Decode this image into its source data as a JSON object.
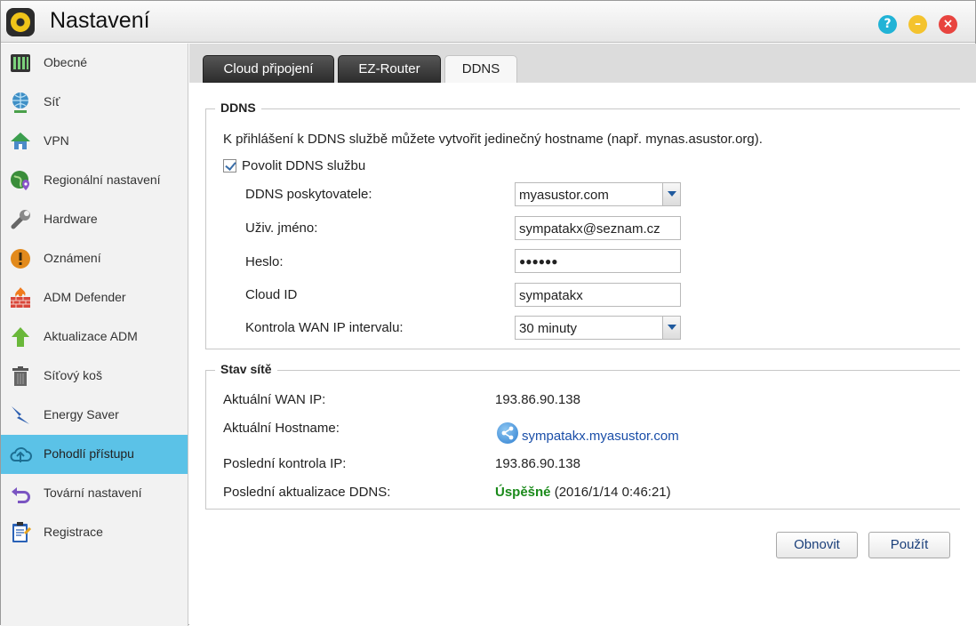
{
  "window": {
    "title": "Nastavení",
    "controls": {
      "help": "?",
      "minimize": "–",
      "close": "×"
    }
  },
  "sidebar": {
    "items": [
      {
        "label": "Obecné",
        "icon": "server-icon"
      },
      {
        "label": "Síť",
        "icon": "globe-network-icon"
      },
      {
        "label": "VPN",
        "icon": "vpn-house-icon"
      },
      {
        "label": "Regionální nastavení",
        "icon": "globe-pin-icon"
      },
      {
        "label": "Hardware",
        "icon": "wrench-icon"
      },
      {
        "label": "Oznámení",
        "icon": "alert-icon"
      },
      {
        "label": "ADM Defender",
        "icon": "firewall-icon"
      },
      {
        "label": "Aktualizace ADM",
        "icon": "up-arrow-icon"
      },
      {
        "label": "Síťový koš",
        "icon": "trash-icon"
      },
      {
        "label": "Energy Saver",
        "icon": "energy-icon"
      },
      {
        "label": "Pohodlí přístupu",
        "icon": "cloud-icon",
        "active": true
      },
      {
        "label": "Tovární nastavení",
        "icon": "undo-icon"
      },
      {
        "label": "Registrace",
        "icon": "clipboard-icon"
      }
    ]
  },
  "tabs": [
    {
      "label": "Cloud připojení"
    },
    {
      "label": "EZ-Router"
    },
    {
      "label": "DDNS",
      "active": true
    }
  ],
  "ddns": {
    "legend": "DDNS",
    "description": "K přihlášení k DDNS službě můžete vytvořit jedinečný hostname (např. mynas.asustor.org).",
    "enable_label": "Povolit DDNS službu",
    "enabled": true,
    "provider_label": "DDNS poskytovatele:",
    "provider_value": "myasustor.com",
    "username_label": "Uživ. jméno:",
    "username_value": "sympatakx@seznam.cz",
    "password_label": "Heslo:",
    "password_value": "●●●●●●",
    "cloud_id_label": "Cloud ID",
    "cloud_id_value": "sympatakx",
    "wan_check_label": "Kontrola WAN IP intervalu:",
    "wan_check_value": "30 minuty"
  },
  "status": {
    "legend": "Stav sítě",
    "wan_ip_label": "Aktuální WAN IP:",
    "wan_ip_value": "193.86.90.138",
    "hostname_label": "Aktuální Hostname:",
    "hostname_value": "sympatakx.myasustor.com",
    "last_check_label": "Poslední kontrola IP:",
    "last_check_value": "193.86.90.138",
    "last_update_label": "Poslední aktualizace DDNS:",
    "last_update_status": "Úspěšné",
    "last_update_time": "(2016/1/14 0:46:21)"
  },
  "buttons": {
    "refresh": "Obnovit",
    "apply": "Použít"
  },
  "colors": {
    "active_sidebar": "#5bc2e7",
    "success": "#1a8a1a",
    "link": "#1a4ea8"
  }
}
